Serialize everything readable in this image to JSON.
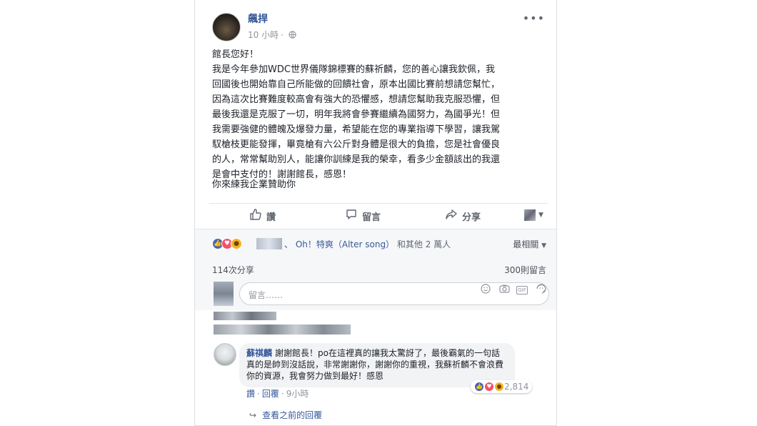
{
  "post": {
    "author": "飆捍",
    "avatar_text": "",
    "time": "10 小時",
    "privacy_icon": "globe-icon",
    "more_icon": "ellipsis-icon",
    "body_lines": [
      "館長您好！",
      "我是今年參加WDC世界儀隊錦標賽的蘇祈麟，您的善心讓我欽佩，我",
      "回國後也開始靠自己所能做的回饋社會，原本出國比賽前想請您幫忙，",
      "因為這次比賽難度較高會有強大的恐懼感，想請您幫助我克服恐懼，但",
      "最後我還是克服了一切，明年我將會參賽繼續為國努力，為國爭光！但",
      "我需要強健的體魄及爆發力量，希望能在您的專業指導下學習，讓我駕",
      "馭槍枝更能發揮，畢竟槍有六公斤對身體是很大的負擔，您是社會優良",
      "的人，常常幫助別人，能讓你訓練是我的榮幸，看多少金額該出的我還",
      "是會中支付的！謝謝館長，感恩！"
    ],
    "extra_line": "你來練我企業贊助你"
  },
  "actions": {
    "like": "讚",
    "comment": "留言",
    "share": "分享"
  },
  "reactions": {
    "icons": [
      "like",
      "love",
      "wow"
    ],
    "text_link": "、 Oh！特爽（Alter song）",
    "text_plain": " 和其他 2 萬人",
    "sort_label": "最相關"
  },
  "counts": {
    "shares": "114次分享",
    "comments": "300則留言"
  },
  "comment_box": {
    "placeholder": "留言……",
    "icons": [
      "emoji-icon",
      "camera-icon",
      "gif-icon",
      "sticker-icon"
    ]
  },
  "reply": {
    "name": "蘇祺麟",
    "text": "謝謝館長！po在這裡真的讓我太驚訝了，最後霸氣的一句話真的是帥到沒話說，非常謝謝你，謝謝你的重視，我蘇祈麟不會浪費你的資源，我會努力做到最好！感恩",
    "reaction_count": "2,814",
    "like": "讚",
    "reply": "回覆",
    "time": "9小時",
    "view_previous": "查看之前的回覆"
  },
  "colors": {
    "link": "#365899",
    "like_blue": "#4267b2",
    "love_red": "#f25268",
    "wow_yellow": "#f7b125"
  }
}
